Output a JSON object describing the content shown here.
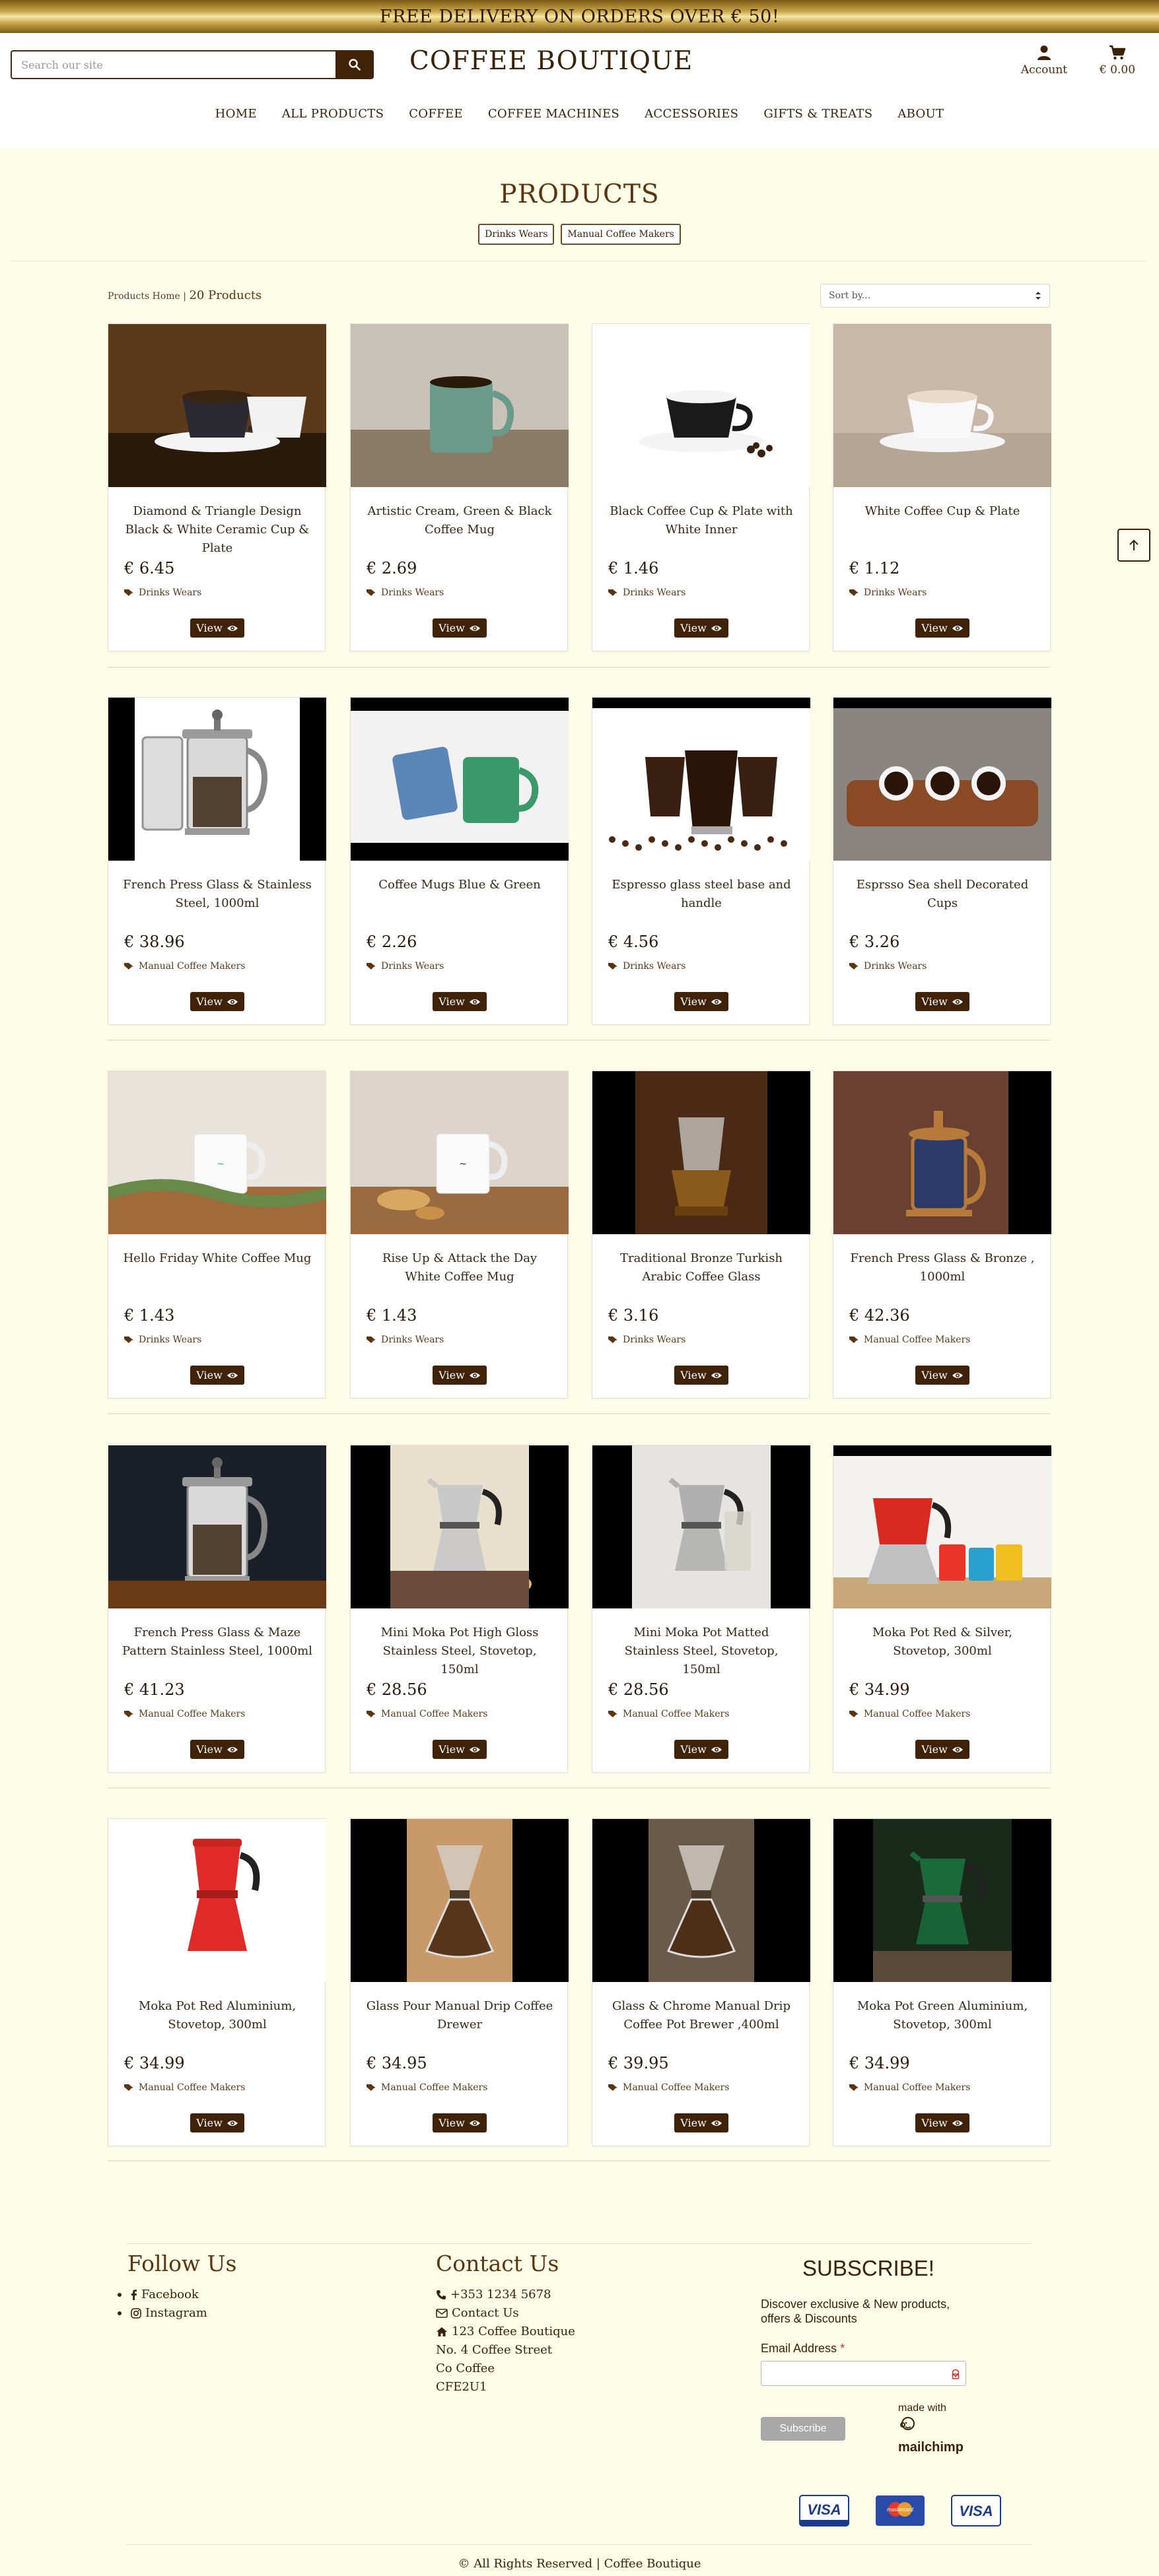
{
  "banner": {
    "text": "FREE DELIVERY ON ORDERS OVER € 50!"
  },
  "header": {
    "search_placeholder": "Search our site",
    "brand": "COFFEE BOUTIQUE",
    "account_label": "Account",
    "cart_total": "€ 0.00"
  },
  "nav": [
    "HOME",
    "ALL PRODUCTS",
    "COFFEE",
    "COFFEE MACHINES",
    "ACCESSORIES",
    "GIFTS & TREATS",
    "ABOUT"
  ],
  "page": {
    "title": "PRODUCTS",
    "categories": [
      "Drinks Wears",
      "Manual Coffee Makers"
    ],
    "breadcrumb": "Products Home",
    "separator": "|",
    "count": "20 Products",
    "sort_placeholder": "Sort by..."
  },
  "view_label": "View",
  "products": [
    {
      "name": "Diamond & Triangle Design Black & White Ceramic Cup & Plate",
      "price": "€ 6.45",
      "category": "Drinks Wears"
    },
    {
      "name": "Artistic Cream, Green & Black Coffee Mug",
      "price": "€ 2.69",
      "category": "Drinks Wears"
    },
    {
      "name": "Black Coffee Cup & Plate with White Inner",
      "price": "€ 1.46",
      "category": "Drinks Wears"
    },
    {
      "name": "White Coffee Cup & Plate",
      "price": "€ 1.12",
      "category": "Drinks Wears"
    },
    {
      "name": "French Press Glass & Stainless Steel, 1000ml",
      "price": "€ 38.96",
      "category": "Manual Coffee Makers"
    },
    {
      "name": "Coffee Mugs Blue & Green",
      "price": "€ 2.26",
      "category": "Drinks Wears"
    },
    {
      "name": "Espresso glass steel base and handle",
      "price": "€ 4.56",
      "category": "Drinks Wears"
    },
    {
      "name": "Esprsso Sea shell Decorated Cups",
      "price": "€ 3.26",
      "category": "Drinks Wears"
    },
    {
      "name": "Hello Friday White Coffee Mug",
      "price": "€ 1.43",
      "category": "Drinks Wears"
    },
    {
      "name": "Rise Up & Attack the Day White Coffee Mug",
      "price": "€ 1.43",
      "category": "Drinks Wears"
    },
    {
      "name": "Traditional Bronze Turkish Arabic Coffee Glass",
      "price": "€ 3.16",
      "category": "Drinks Wears"
    },
    {
      "name": "French Press Glass & Bronze , 1000ml",
      "price": "€ 42.36",
      "category": "Manual Coffee Makers"
    },
    {
      "name": "French Press Glass & Maze Pattern Stainless Steel, 1000ml",
      "price": "€ 41.23",
      "category": "Manual Coffee Makers"
    },
    {
      "name": "Mini Moka Pot High Gloss Stainless Steel, Stovetop, 150ml",
      "price": "€ 28.56",
      "category": "Manual Coffee Makers"
    },
    {
      "name": "Mini Moka Pot Matted Stainless Steel, Stovetop, 150ml",
      "price": "€ 28.56",
      "category": "Manual Coffee Makers"
    },
    {
      "name": "Moka Pot Red & Silver, Stovetop, 300ml",
      "price": "€ 34.99",
      "category": "Manual Coffee Makers"
    },
    {
      "name": "Moka Pot Red Aluminium, Stovetop, 300ml",
      "price": "€ 34.99",
      "category": "Manual Coffee Makers"
    },
    {
      "name": "Glass Pour Manual Drip Coffee Drewer",
      "price": "€ 34.95",
      "category": "Manual Coffee Makers"
    },
    {
      "name": "Glass & Chrome Manual Drip Coffee Pot Brewer ,400ml",
      "price": "€ 39.95",
      "category": "Manual Coffee Makers"
    },
    {
      "name": "Moka Pot Green Aluminium, Stovetop, 300ml",
      "price": "€ 34.99",
      "category": "Manual Coffee Makers"
    }
  ],
  "footer": {
    "follow_title": "Follow Us",
    "facebook": "Facebook",
    "instagram": "Instagram",
    "contact_title": "Contact Us",
    "phone": "+353 1234 5678",
    "contact_link": "Contact Us",
    "address_1": "123 Coffee Boutique",
    "address_2": "No. 4 Coffee Street",
    "address_3": "Co Coffee",
    "address_4": "CFE2U1",
    "subscribe_title": "SUBSCRIBE!",
    "subscribe_text": "Discover exclusive & New products, offers & Discounts",
    "email_label": "Email Address",
    "required_mark": "*",
    "subscribe_button": "Subscribe",
    "made_with": "made with",
    "mailchimp": "mailchimp",
    "copyright": "© All Rights Reserved | Coffee Boutique",
    "payment_cards": [
      "VISA",
      "mastercard",
      "VISA"
    ]
  },
  "colors": {
    "brand_brown": "#3f2207",
    "page_bg": "#fefde8",
    "banner_gold": "#c9a64a"
  }
}
